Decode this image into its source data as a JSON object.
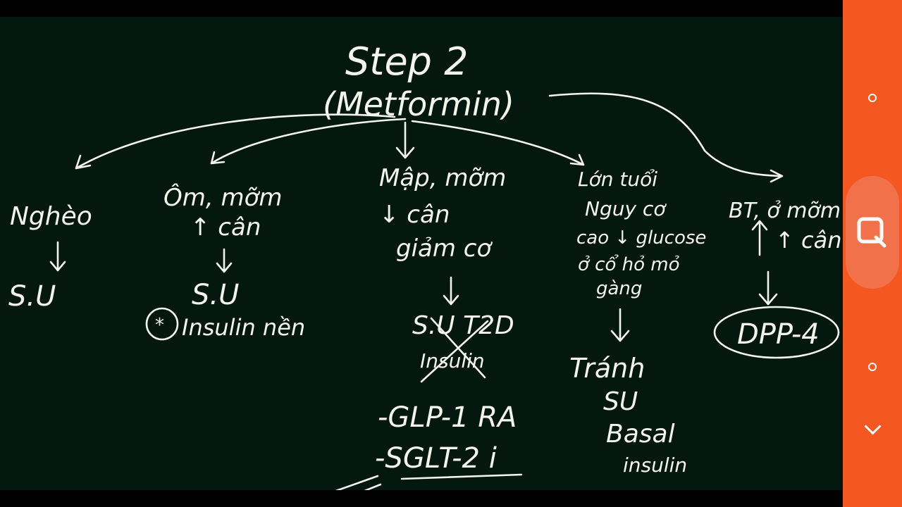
{
  "board": {
    "title": "Step 2",
    "subtitle": "(Metformin)",
    "branches": [
      {
        "lines": [
          "Nghèo"
        ],
        "arrow_to": "S.U"
      },
      {
        "lines": [
          "Ôm, mỡm",
          "↑ cân"
        ],
        "arrow_to": "S.U",
        "note": "Insulin nền"
      },
      {
        "lines": [
          "Mập, mỡm",
          "↓ cân",
          "giảm cơ"
        ],
        "arrow_to": "S.U  T2D",
        "crossed": "Insulin",
        "options": [
          "-GLP-1 RA",
          "-SGLT-2 i"
        ]
      },
      {
        "lines": [
          "Lớn tuổi",
          "Nguy cơ",
          "cao ↓ glucose",
          "ở cổ hỏ mỏ",
          "gàng"
        ],
        "arrow_to": "Tránh",
        "after": [
          "SU",
          "Basal",
          "insulin"
        ]
      },
      {
        "lines": [
          "BT, ở mỡm",
          "↑ cân"
        ],
        "arrow_to": "DPP-4"
      }
    ]
  },
  "nav": {
    "icons": [
      "circle-icon",
      "square-icon",
      "circle-icon",
      "chevron-down-icon"
    ],
    "accent": "#f4571f"
  }
}
